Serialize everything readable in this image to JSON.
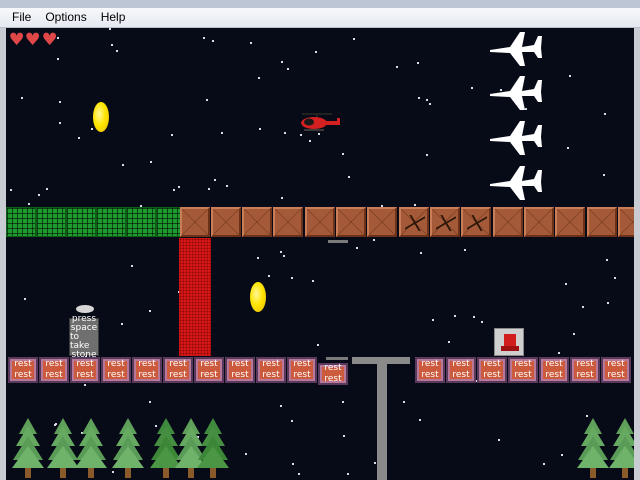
{
  "menu": {
    "items": [
      {
        "id": "file",
        "label": "File"
      },
      {
        "id": "options",
        "label": "Options"
      },
      {
        "id": "help",
        "label": "Help"
      }
    ]
  },
  "hud": {
    "lives": 3,
    "heart_icon": "heart-icon"
  },
  "blocks": {
    "rest_lines": [
      "rest",
      "rest"
    ]
  },
  "sign": {
    "lines": [
      "press",
      "space",
      "to take",
      "stone"
    ]
  },
  "colors": {
    "background": "#070b17",
    "grass": "#1f9a2e",
    "crate": "#a45a38",
    "lava": "#d81616",
    "rest_block": "#cc5a3c",
    "heart": "#e04848",
    "coin": "#ffe500"
  },
  "sprites": {
    "player": "helicopter-icon",
    "enemy": "jet-icon",
    "pickup": "coin-icon",
    "decor": "pine-tree-icon"
  }
}
